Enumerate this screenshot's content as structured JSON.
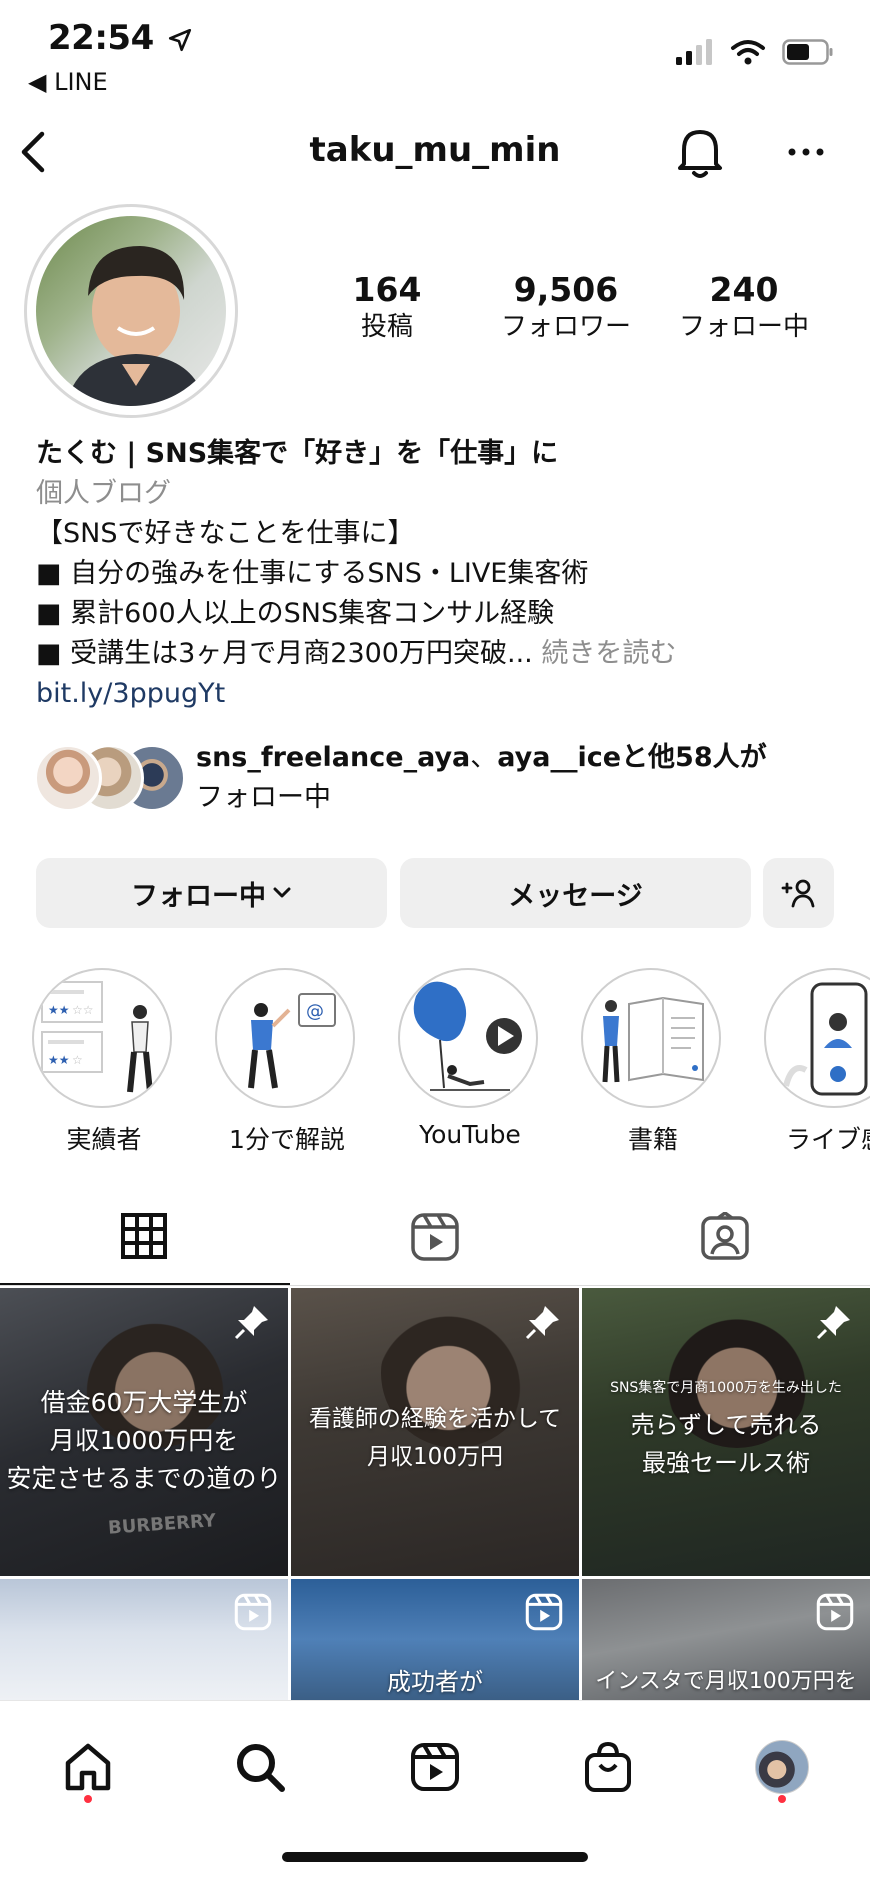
{
  "status_bar": {
    "time": "22:54",
    "back_app": "◀ LINE"
  },
  "header": {
    "username": "taku_mu_min"
  },
  "stats": [
    {
      "value": "164",
      "label": "投稿"
    },
    {
      "value": "9,506",
      "label": "フォロワー"
    },
    {
      "value": "240",
      "label": "フォロー中"
    }
  ],
  "bio": {
    "name": "たくむ | SNS集客で「好き」を「仕事」に",
    "category": "個人ブログ",
    "lines": [
      "【SNSで好きなことを仕事に】",
      "■ 自分の強みを仕事にするSNS・LIVE集客術",
      "■ 累計600人以上のSNS集客コンサル経験",
      "■ 受講生は3ヶ月で月商2300万円突破..."
    ],
    "more": "続きを読む",
    "link": "bit.ly/3ppugYt"
  },
  "followed_by": {
    "user1": "sns_freelance_aya",
    "sep": "、",
    "user2": "aya__ice",
    "tail": "と他58人が",
    "line2": "フォロー中"
  },
  "buttons": {
    "following": "フォロー中",
    "message": "メッセージ"
  },
  "highlights": [
    {
      "label": "実績者"
    },
    {
      "label": "1分で解説"
    },
    {
      "label": "YouTube"
    },
    {
      "label": "書籍"
    },
    {
      "label": "ライブ感"
    }
  ],
  "grid": {
    "row1": [
      {
        "text": [
          "借金60万大学生が",
          "月収1000万円を",
          "安定させるまでの道のり"
        ],
        "overlay": "BURBERRY"
      },
      {
        "text": [
          "看護師の経験を活かして",
          "月収100万円"
        ]
      },
      {
        "small": "SNS集客で月商1000万を生み出した",
        "text": [
          "売らずして売れる",
          "最強セールス術"
        ]
      }
    ],
    "row2": [
      {
        "text": []
      },
      {
        "text": [
          "成功者が"
        ]
      },
      {
        "text": [
          "インスタで月収100万円を"
        ]
      }
    ]
  },
  "colors": {
    "accent_link": "#1f3a64",
    "notification_dot": "#ff3040",
    "button_bg": "#efefef"
  }
}
